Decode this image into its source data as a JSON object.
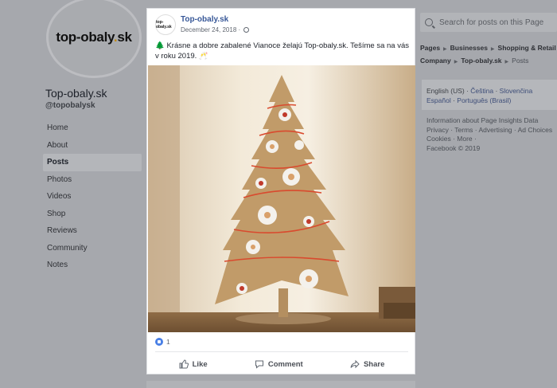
{
  "page": {
    "logo_text_a": "top-obaly",
    "logo_text_dot": ".",
    "logo_text_b": "sk",
    "name": "Top-obaly.sk",
    "handle": "@topobalysk"
  },
  "nav": [
    "Home",
    "About",
    "Posts",
    "Photos",
    "Videos",
    "Shop",
    "Reviews",
    "Community",
    "Notes"
  ],
  "nav_active": "Posts",
  "search": {
    "placeholder": "Search for posts on this Page"
  },
  "breadcrumb": {
    "items": [
      "Pages",
      "Businesses",
      "Shopping & Retail",
      "Company",
      "Top-obaly.sk"
    ],
    "current": "Posts"
  },
  "languages": {
    "line1": [
      "English (US)",
      "Čeština",
      "Slovenčina"
    ],
    "line2": [
      "Español",
      "Português (Brasil)"
    ]
  },
  "footer": {
    "line1": "Information about Page Insights Data",
    "line2": "Privacy · Terms · Advertising · Ad Choices",
    "line3": "Cookies · More ·",
    "line4": "Facebook © 2019"
  },
  "post": {
    "author": "Top-obaly.sk",
    "avatar_text": "top-obaly.sk",
    "date": "December 24, 2018 ·",
    "text": "🌲 Krásne a dobre zabalené Vianoce želajú Top-obaly.sk. Tešíme sa na vás v roku 2019. 🥂",
    "reaction_count": "1",
    "actions": {
      "like": "Like",
      "comment": "Comment",
      "share": "Share"
    }
  }
}
